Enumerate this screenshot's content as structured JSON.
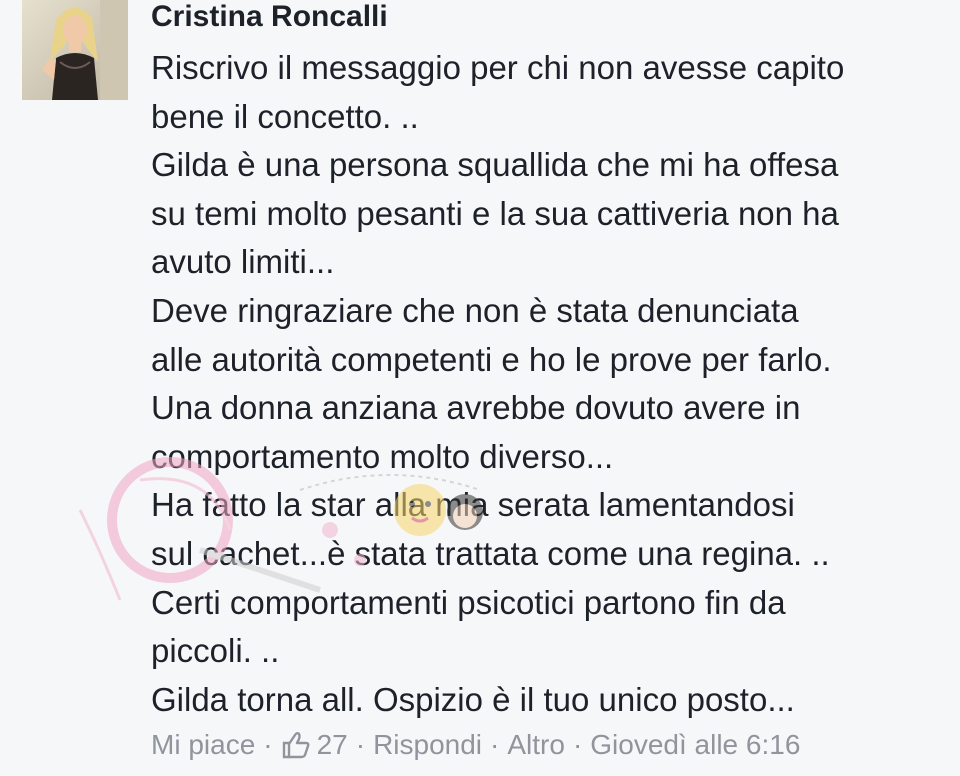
{
  "post": {
    "author": "Cristina Roncalli",
    "lines": [
      "Riscrivo il messaggio per chi non avesse capito",
      "bene il concetto. ..",
      "Gilda è una persona squallida che mi ha offesa",
      "su temi molto pesanti e la sua cattiveria non ha",
      "avuto limiti...",
      "Deve ringraziare che non è stata denunciata",
      "alle autorità competenti e ho le prove per farlo.",
      "Una donna anziana avrebbe dovuto avere in",
      "comportamento molto diverso...",
      "Ha fatto la star alla mia serata lamentandosi",
      "sul cachet...è stata trattata come una regina. ..",
      "Certi comportamenti psicotici partono fin da",
      "piccoli. ..",
      "Gilda torna all. Ospizio è il tuo unico posto..."
    ]
  },
  "actions": {
    "like_label": "Mi piace",
    "like_count": "27",
    "reply_label": "Rispondi",
    "more_label": "Altro",
    "timestamp": "Giovedì alle 6:16",
    "separator": "·"
  },
  "colors": {
    "text": "#1d2129",
    "meta": "#90949c",
    "background": "#f6f7f9"
  },
  "icons": {
    "like": "thumbs-up-icon"
  }
}
